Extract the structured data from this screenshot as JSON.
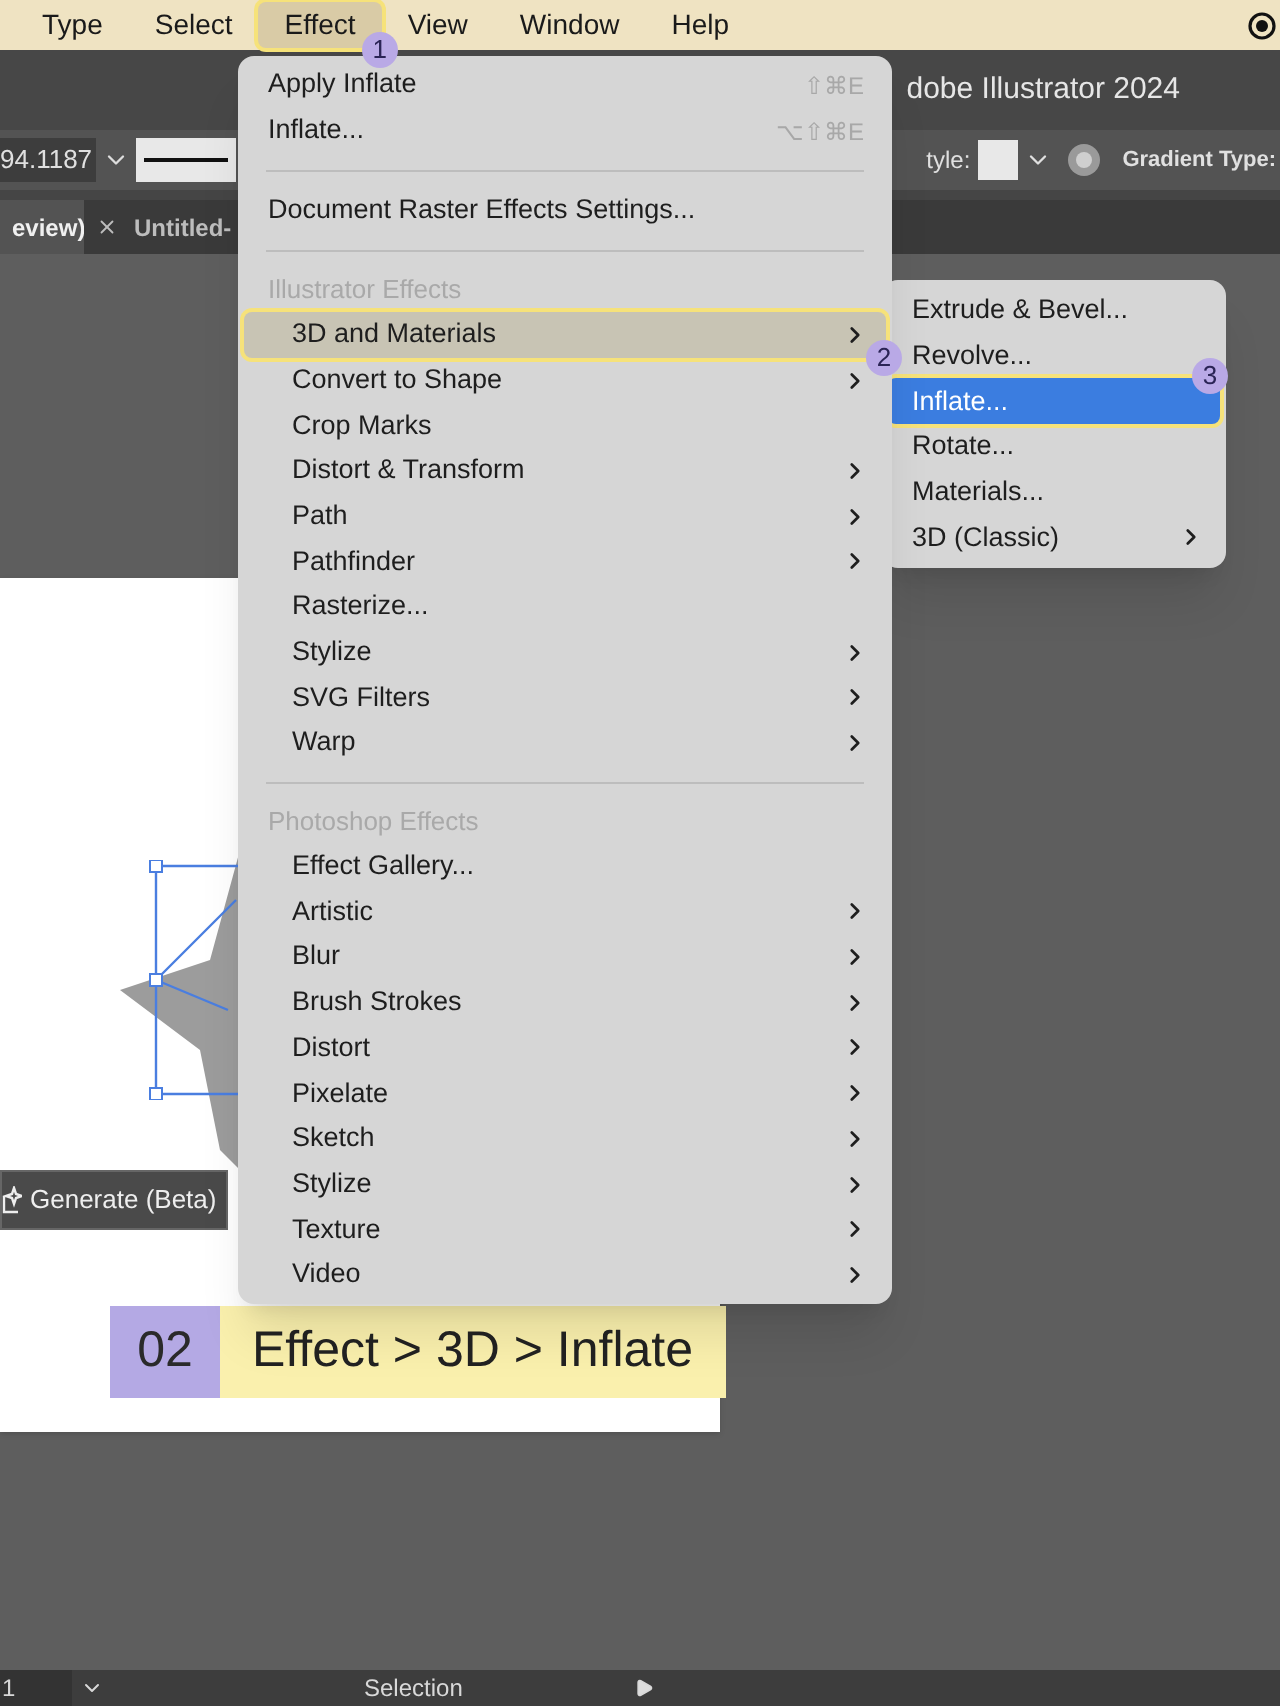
{
  "menu_bar": {
    "items": [
      {
        "label": "Type",
        "selected": false
      },
      {
        "label": "Select",
        "selected": false
      },
      {
        "label": "Effect",
        "selected": true,
        "badge": "1"
      },
      {
        "label": "View",
        "selected": false
      },
      {
        "label": "Window",
        "selected": false
      },
      {
        "label": "Help",
        "selected": false
      }
    ]
  },
  "title_bar": {
    "title": "dobe Illustrator 2024"
  },
  "control_bar": {
    "value": "94.1187",
    "style_label": "tyle:",
    "gradient_label": "Gradient Type:"
  },
  "tabs": [
    {
      "label": "eview)",
      "selected": true
    },
    {
      "label": "Untitled-",
      "selected": false
    }
  ],
  "generate_button": {
    "label": "Generate (Beta)"
  },
  "menu": {
    "items": [
      {
        "kind": "command",
        "label": "Apply Inflate",
        "shortcut": "⇧⌘E"
      },
      {
        "kind": "command",
        "label": "Inflate...",
        "shortcut": "⌥⇧⌘E"
      },
      {
        "kind": "separator"
      },
      {
        "kind": "command",
        "label": "Document Raster Effects Settings..."
      },
      {
        "kind": "separator"
      },
      {
        "kind": "header",
        "label": "Illustrator Effects"
      },
      {
        "kind": "effect",
        "label": "3D and Materials",
        "submenu": true,
        "selected": true,
        "badge": "2"
      },
      {
        "kind": "effect",
        "label": "Convert to Shape",
        "submenu": true,
        "selected": false
      },
      {
        "kind": "effect",
        "label": "Crop Marks",
        "submenu": false,
        "selected": false
      },
      {
        "kind": "effect",
        "label": "Distort & Transform",
        "submenu": true,
        "selected": false
      },
      {
        "kind": "effect",
        "label": "Path",
        "submenu": true,
        "selected": false
      },
      {
        "kind": "effect",
        "label": "Pathfinder",
        "submenu": true,
        "selected": false
      },
      {
        "kind": "effect",
        "label": "Rasterize...",
        "submenu": false,
        "selected": false
      },
      {
        "kind": "effect",
        "label": "Stylize",
        "submenu": true,
        "selected": false
      },
      {
        "kind": "effect",
        "label": "SVG Filters",
        "submenu": true,
        "selected": false
      },
      {
        "kind": "effect",
        "label": "Warp",
        "submenu": true,
        "selected": false
      },
      {
        "kind": "separator"
      },
      {
        "kind": "header",
        "label": "Photoshop Effects"
      },
      {
        "kind": "effect",
        "label": "Effect Gallery...",
        "submenu": false,
        "selected": false
      },
      {
        "kind": "effect",
        "label": "Artistic",
        "submenu": true,
        "selected": false
      },
      {
        "kind": "effect",
        "label": "Blur",
        "submenu": true,
        "selected": false
      },
      {
        "kind": "effect",
        "label": "Brush Strokes",
        "submenu": true,
        "selected": false
      },
      {
        "kind": "effect",
        "label": "Distort",
        "submenu": true,
        "selected": false
      },
      {
        "kind": "effect",
        "label": "Pixelate",
        "submenu": true,
        "selected": false
      },
      {
        "kind": "effect",
        "label": "Sketch",
        "submenu": true,
        "selected": false
      },
      {
        "kind": "effect",
        "label": "Stylize",
        "submenu": true,
        "selected": false
      },
      {
        "kind": "effect",
        "label": "Texture",
        "submenu": true,
        "selected": false
      },
      {
        "kind": "effect",
        "label": "Video",
        "submenu": true,
        "selected": false
      }
    ]
  },
  "submenu": {
    "items": [
      {
        "label": "Extrude & Bevel...",
        "submenu": false,
        "selected": false
      },
      {
        "label": "Revolve...",
        "submenu": false,
        "selected": false
      },
      {
        "label": "Inflate...",
        "submenu": false,
        "selected": true,
        "badge": "3"
      },
      {
        "label": "Rotate...",
        "submenu": false,
        "selected": false
      },
      {
        "label": "Materials...",
        "submenu": false,
        "selected": false
      },
      {
        "label": "3D (Classic)",
        "submenu": true,
        "selected": false
      }
    ]
  },
  "caption": {
    "step": "02",
    "text": "Effect > 3D > Inflate"
  },
  "status_bar": {
    "zoom": "1",
    "tool": "Selection"
  }
}
